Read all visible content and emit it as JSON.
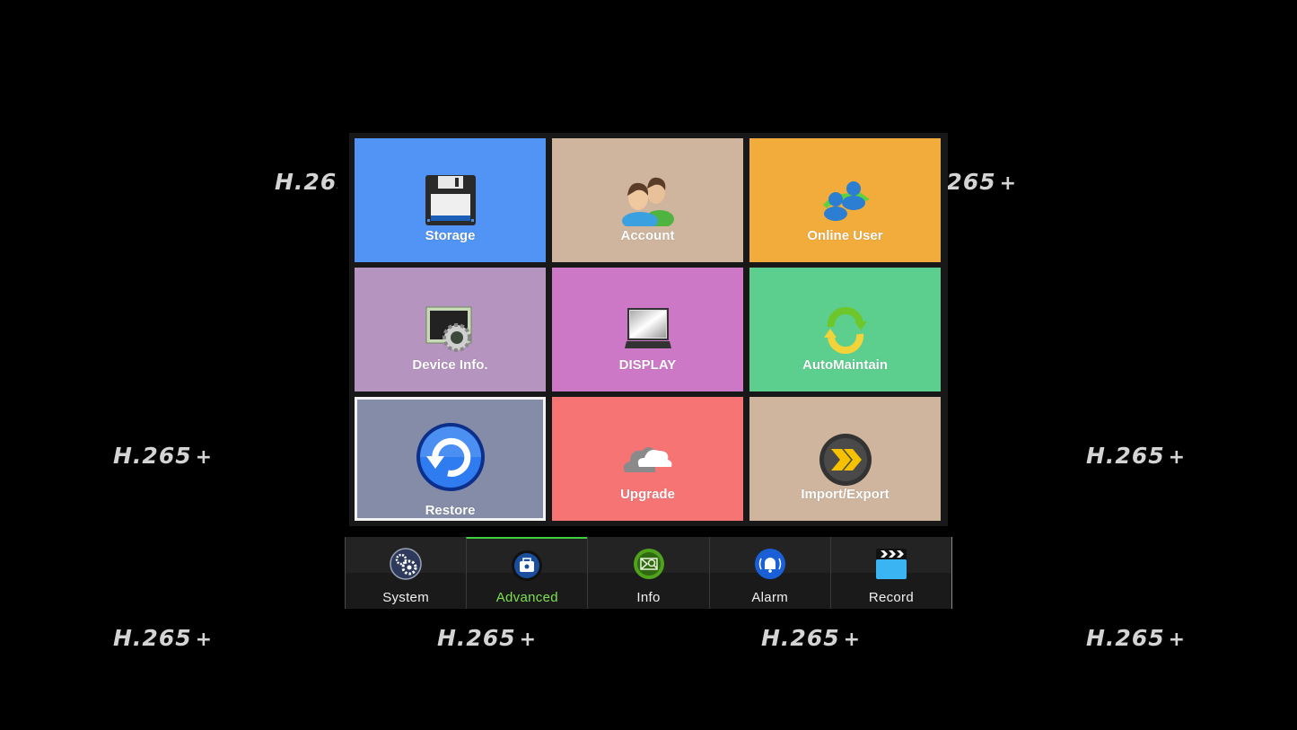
{
  "watermark": {
    "text": "H.265",
    "suffix": "+"
  },
  "tiles": [
    {
      "label": "Storage",
      "icon": "floppy-disk-icon",
      "color": "#5294f5"
    },
    {
      "label": "Account",
      "icon": "users-icon",
      "color": "#cfb59d"
    },
    {
      "label": "Online User",
      "icon": "online-users-icon",
      "color": "#f2ac3c"
    },
    {
      "label": "Device Info.",
      "icon": "device-settings-icon",
      "color": "#b594bf"
    },
    {
      "label": "DISPLAY",
      "icon": "laptop-icon",
      "color": "#cc78c6"
    },
    {
      "label": "AutoMaintain",
      "icon": "refresh-cycle-icon",
      "color": "#5ccf8e"
    },
    {
      "label": "Restore",
      "icon": "restore-icon",
      "color": "#848ca8",
      "selected": true
    },
    {
      "label": "Upgrade",
      "icon": "cloud-icon",
      "color": "#f77475"
    },
    {
      "label": "Import/Export",
      "icon": "fast-forward-icon",
      "color": "#cfb59d"
    }
  ],
  "tabs": [
    {
      "label": "System",
      "icon": "gears-icon"
    },
    {
      "label": "Advanced",
      "icon": "toolbox-icon",
      "active": true
    },
    {
      "label": "Info",
      "icon": "info-search-icon"
    },
    {
      "label": "Alarm",
      "icon": "bell-icon"
    },
    {
      "label": "Record",
      "icon": "clapperboard-icon"
    }
  ]
}
